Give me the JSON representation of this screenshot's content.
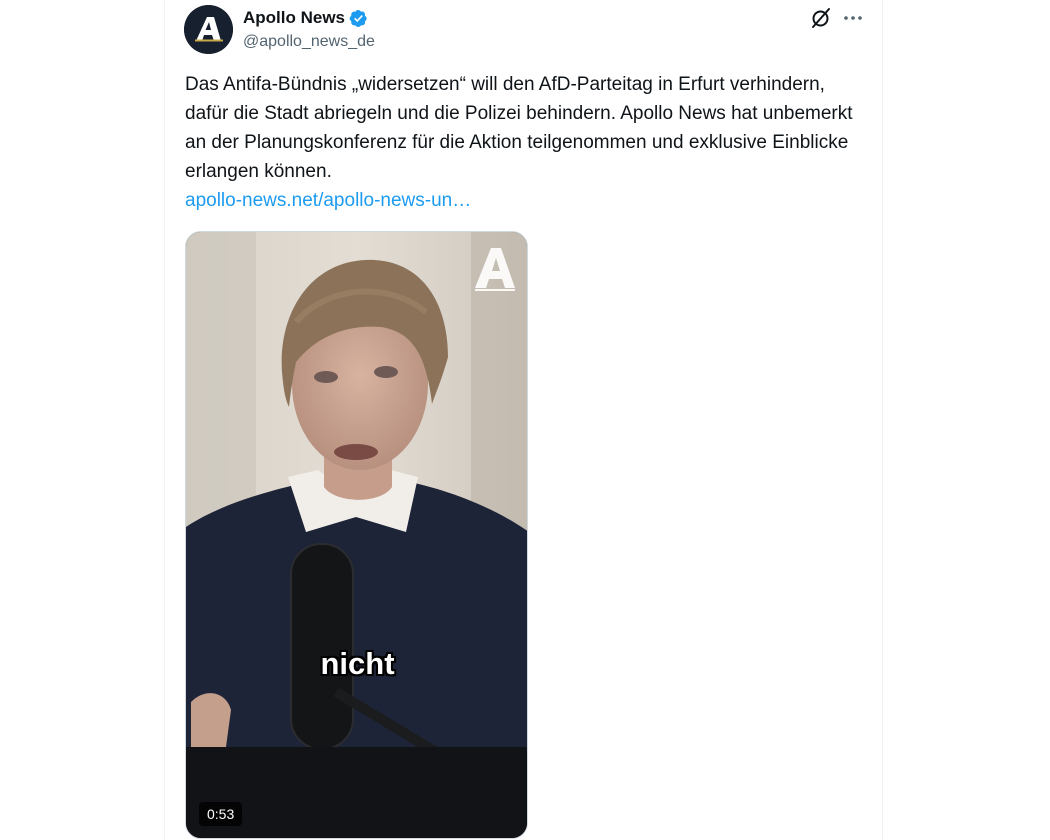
{
  "author": {
    "name": "Apollo News",
    "handle": "@apollo_news_de",
    "verified": true,
    "avatar_letter": "A"
  },
  "post": {
    "text": "Das Antifa-Bündnis „widersetzen“ will den AfD-Parteitag in Erfurt verhindern, dafür die Stadt abriegeln und die Polizei behindern. Apollo News hat unbemerkt an der Planungskonferenz für die Aktion teilgenommen und exklusive Einblicke erlangen können.",
    "link_text": "apollo-news.net/apollo-news-un…"
  },
  "media": {
    "type": "video",
    "subtitle": "nicht",
    "duration": "0:53",
    "watermark_letter": "A"
  },
  "icons": {
    "grok": "grok-icon",
    "more": "more-icon",
    "verified": "verified-badge-icon"
  },
  "colors": {
    "text": "#0f1419",
    "secondary": "#536471",
    "link": "#1d9bf0",
    "verified": "#1d9bf0",
    "avatar_bg": "#16202e"
  }
}
